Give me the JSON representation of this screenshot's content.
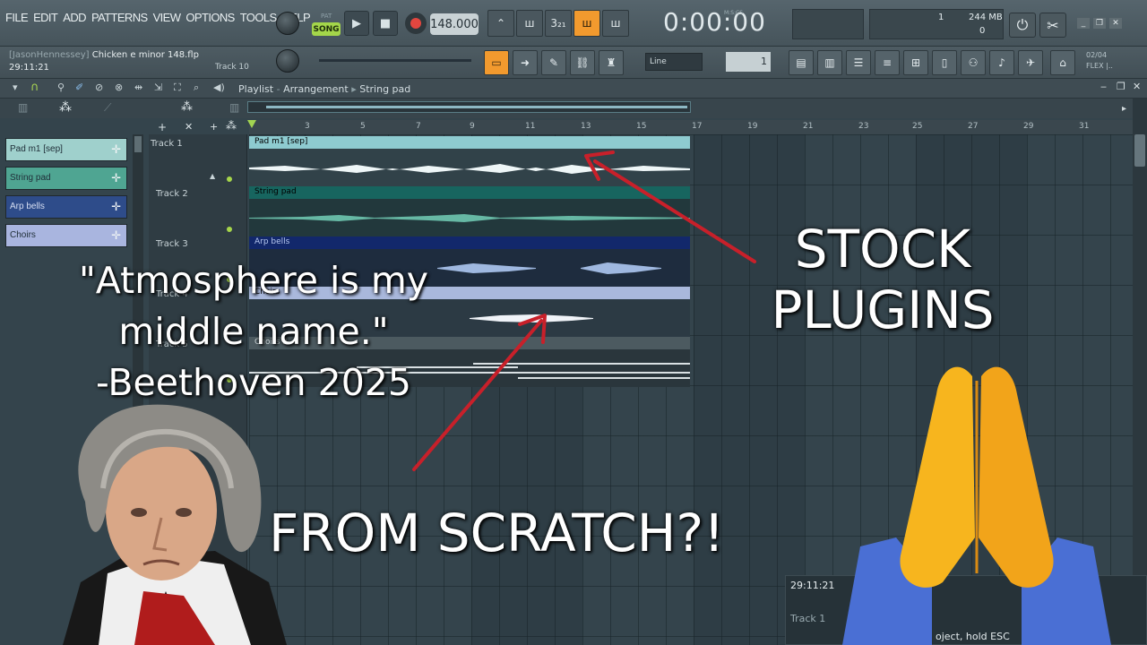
{
  "menu": [
    "FILE",
    "EDIT",
    "ADD",
    "PATTERNS",
    "VIEW",
    "OPTIONS",
    "TOOLS",
    "HELP"
  ],
  "transport": {
    "pat_label": "PAT",
    "song_label": "SONG",
    "play": "▶",
    "stop": "■",
    "tempo": "148.000",
    "time": "0:00:00",
    "time_unit_label": "M:S:CS"
  },
  "cpu": {
    "value": "1",
    "memory": "244 MB",
    "voices": "0"
  },
  "project": {
    "author": "[JasonHennessey]",
    "file": "Chicken e minor 148.flp",
    "time": "29:11:21",
    "track": "Track 10"
  },
  "snap": {
    "value": "Line",
    "step": "1"
  },
  "flex": {
    "line1": "02/04",
    "line2": "FLEX |.."
  },
  "playlist": {
    "title": "Playlist",
    "section": "Arrangement",
    "pattern": "String pad"
  },
  "patterns": [
    {
      "label": "Pad m1 [sep]",
      "color": "#9fd0cc"
    },
    {
      "label": "String pad",
      "color": "#4fa592"
    },
    {
      "label": "Arp bells",
      "color": "#2e4c8a"
    },
    {
      "label": "Choirs",
      "color": "#a9b5df"
    }
  ],
  "tracks": [
    "Track 1",
    "Track 2",
    "Track 3",
    "Track 4",
    "Track 5"
  ],
  "ruler": [
    "3",
    "5",
    "7",
    "9",
    "11",
    "13",
    "15",
    "17",
    "19",
    "21",
    "23",
    "25",
    "27",
    "29",
    "31"
  ],
  "clips": [
    {
      "label": "Pad m1 [sep]",
      "head": "#8ecbd0",
      "body": "#314249",
      "wave": "#eef6f7"
    },
    {
      "label": "String pad",
      "head": "#17655f",
      "body": "#22383c",
      "wave": "#66b8a4"
    },
    {
      "label": "Arp bells",
      "head": "#12286b",
      "body": "#1e2c3e",
      "wave": "#9fb8e0"
    },
    {
      "label": "Choirs",
      "head": "#a9b8dc",
      "body": "#2c3a44",
      "wave": "#f0f3f8"
    },
    {
      "label": "Choirs 2",
      "head": "#4c5a60",
      "body": "#2a363c",
      "wave": "#d9e0e3"
    }
  ],
  "hint": {
    "time": "29:11:21",
    "track": "Track 1",
    "text": "oject, hold ESC"
  },
  "overlay": {
    "quote_line1": "\"Atmosphere is my",
    "quote_line2": "middle name.\"",
    "quote_line3": "-Beethoven 2025",
    "stock_line1": "STOCK",
    "stock_line2": "PLUGINS",
    "scratch": "FROM SCRATCH?!",
    "arrow_color": "#c8202a"
  }
}
